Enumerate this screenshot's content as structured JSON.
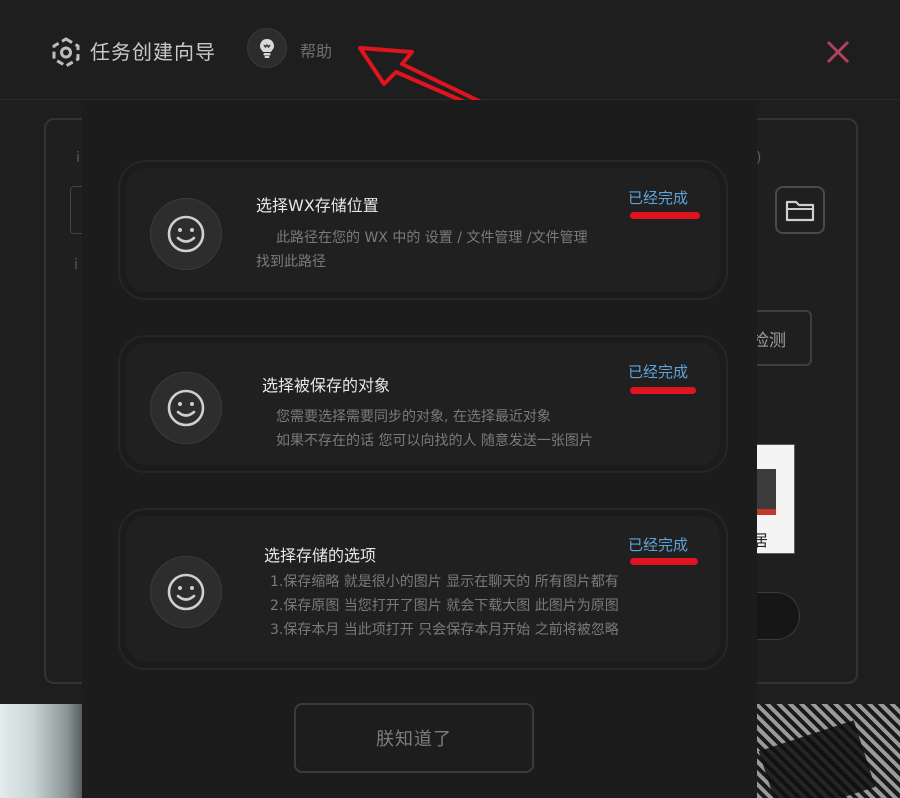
{
  "header": {
    "title": "任务创建向导",
    "help_label": "帮助",
    "logo_icon": "logo-cube-icon",
    "help_icon": "lightbulb-icon",
    "close_icon": "close-icon"
  },
  "background": {
    "fragment_a": "i",
    "fragment_b": "i",
    "fragment_c": ")",
    "detect_label": "检测",
    "thumb_text": "居"
  },
  "cards": [
    {
      "title": "选择WX存储位置",
      "status": "已经完成",
      "lines": [
        "此路径在您的 WX 中的  设置  /  文件管理  /文件管理",
        "找到此路径"
      ]
    },
    {
      "title": "选择被保存的对象",
      "status": "已经完成",
      "lines": [
        "您需要选择需要同步的对象,  在选择最近对象",
        "如果不存在的话 您可以向找的人 随意发送一张图片"
      ]
    },
    {
      "title": "选择存储的选项",
      "status": "已经完成",
      "lines": [
        "1.保存缩略  就是很小的图片 显示在聊天的 所有图片都有",
        "2.保存原图  当您打开了图片 就会下载大图 此图片为原图",
        "3.保存本月  当此项打开 只会保存本月开始 之前将被忽略"
      ]
    }
  ],
  "ok_button": "朕知道了",
  "colors": {
    "status": "#5fa3d8",
    "annotation": "#e0141e",
    "close": "#b0425a"
  }
}
